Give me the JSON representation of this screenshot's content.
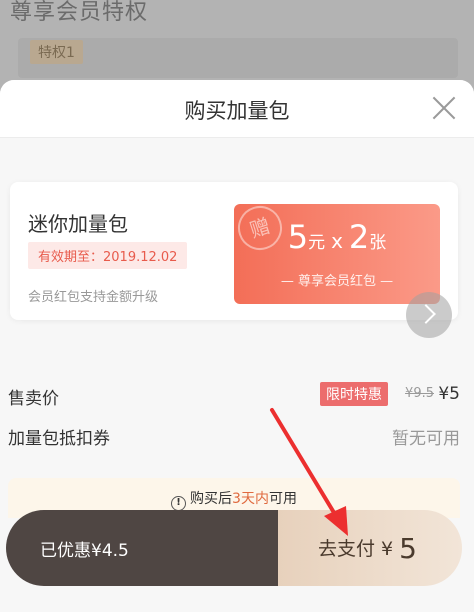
{
  "background": {
    "title": "尊享会员特权",
    "tag": "特权1"
  },
  "sheet": {
    "title": "购买加量包"
  },
  "package": {
    "name": "迷你加量包",
    "validity": "有效期至：2019.12.02",
    "note": "会员红包支持金额升级",
    "coupon": {
      "stamp": "赠",
      "amount": "5",
      "amount_unit": "元",
      "times_symbol": "x",
      "count": "2",
      "count_unit": "张",
      "subtitle": "— 尊享会员红包 —"
    }
  },
  "price": {
    "label": "售卖价",
    "badge": "限时特惠",
    "original": "¥9.5",
    "current": "¥5"
  },
  "voucher": {
    "label": "加量包抵扣券",
    "value": "暂无可用"
  },
  "notice": {
    "prefix": "购买后",
    "highlight": "3天内",
    "suffix": "可用"
  },
  "pay": {
    "discount": "已优惠¥4.5",
    "button_label": "去支付 ¥",
    "amount": "5"
  },
  "colors": {
    "coupon_start": "#f36e57",
    "coupon_end": "#fb9a88",
    "badge": "#ec6d6d",
    "pay_dark": "#4f4643",
    "pay_gold": "#e7d1bc",
    "annotation_arrow": "#ec2f2f"
  }
}
